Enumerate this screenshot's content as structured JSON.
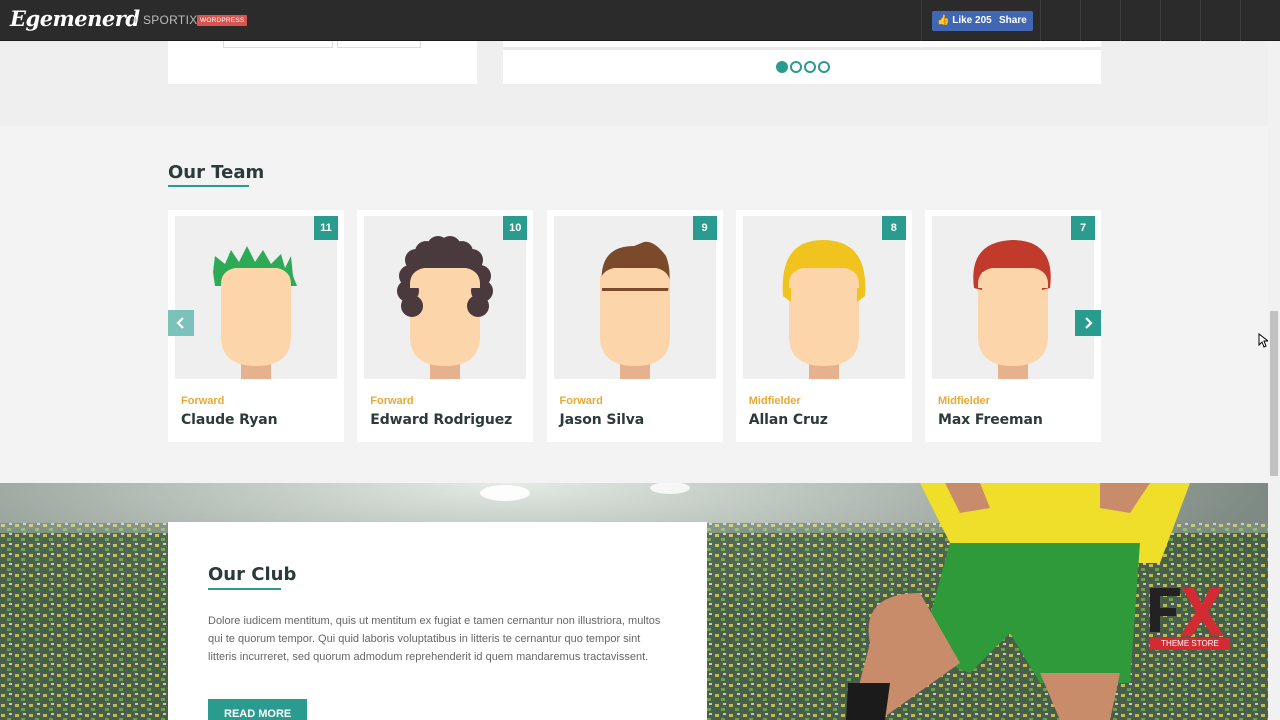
{
  "topbar": {
    "logo": "Egemenerd",
    "theme_link": "+ SPORTIX",
    "badge": "WORDPRESS",
    "fb_like": "Like 205",
    "fb_share": "Share"
  },
  "slider": {
    "dots_total": 4,
    "active_dot": 1
  },
  "team": {
    "title": "Our Team",
    "players": [
      {
        "number": "11",
        "position": "Forward",
        "name": "Claude Ryan"
      },
      {
        "number": "10",
        "position": "Forward",
        "name": "Edward Rodriguez"
      },
      {
        "number": "9",
        "position": "Forward",
        "name": "Jason Silva"
      },
      {
        "number": "8",
        "position": "Midfielder",
        "name": "Allan Cruz"
      },
      {
        "number": "7",
        "position": "Midfielder",
        "name": "Max Freeman"
      }
    ]
  },
  "club": {
    "title": "Our Club",
    "text": "Dolore iudicem mentitum, quis ut mentitum ex fugiat e tamen cernantur non illustriora, multos qui te quorum tempor. Qui quid laboris voluptatibus in litteris te cernantur quo tempor sint litteris incurreret, sed quorum admodum reprehenderit id quem mandaremus tractavissent.",
    "button": "READ MORE"
  },
  "watermark": {
    "main": "FX",
    "sub": "THEME STORE"
  },
  "colors": {
    "accent": "#2a9b8f",
    "position": "#e8a935",
    "topbar": "#2b2b2b"
  }
}
